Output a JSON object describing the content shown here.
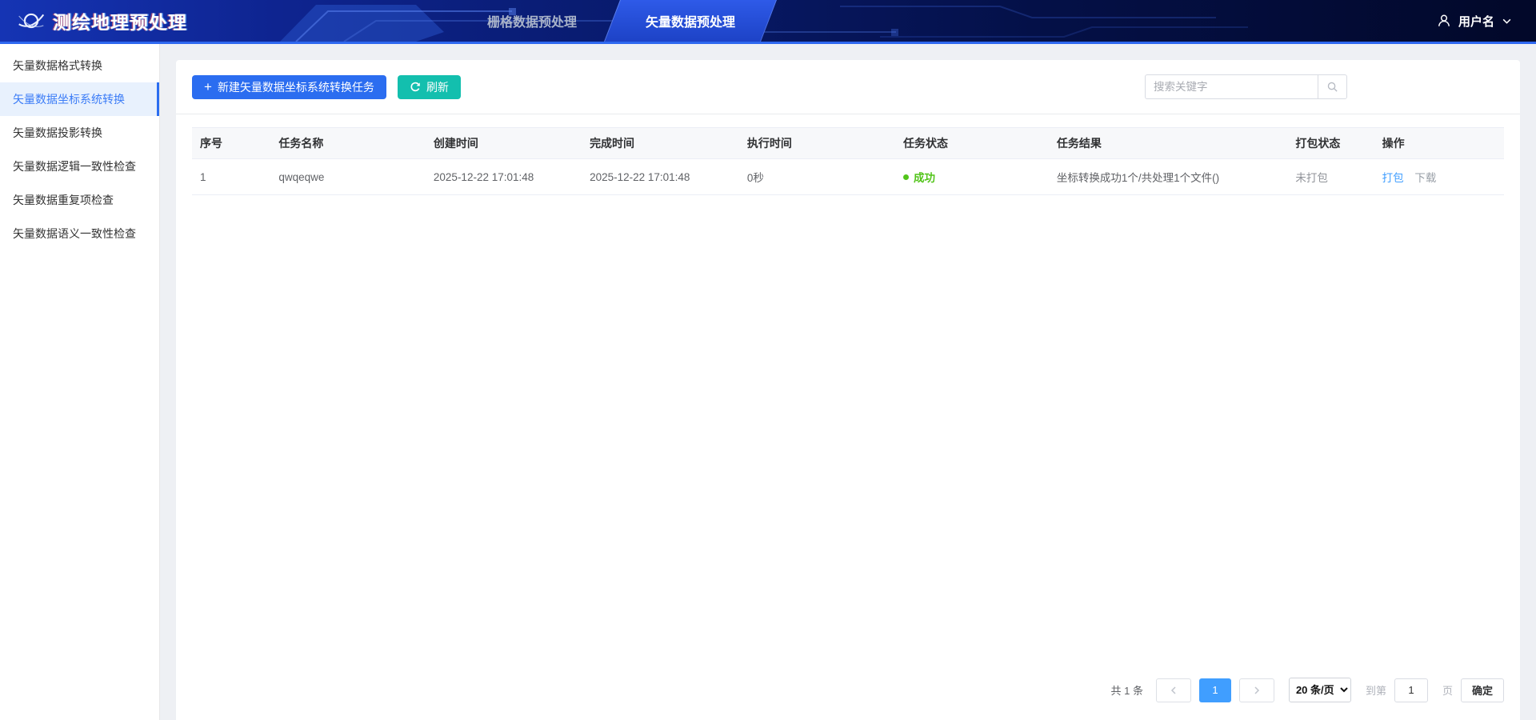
{
  "header": {
    "app_title": "测绘地理预处理",
    "tabs": [
      {
        "label": "栅格数据预处理",
        "active": false
      },
      {
        "label": "矢量数据预处理",
        "active": true
      }
    ],
    "user_name": "用户名"
  },
  "sidebar": {
    "items": [
      {
        "label": "矢量数据格式转换",
        "active": false
      },
      {
        "label": "矢量数据坐标系统转换",
        "active": true
      },
      {
        "label": "矢量数据投影转换",
        "active": false
      },
      {
        "label": "矢量数据逻辑一致性检查",
        "active": false
      },
      {
        "label": "矢量数据重复项检查",
        "active": false
      },
      {
        "label": "矢量数据语义一致性检查",
        "active": false
      }
    ]
  },
  "toolbar": {
    "new_task_label": "新建矢量数据坐标系统转换任务",
    "refresh_label": "刷新",
    "search_placeholder": "搜索关键字"
  },
  "icons": {
    "plus": "+"
  },
  "table": {
    "columns": [
      "序号",
      "任务名称",
      "创建时间",
      "完成时间",
      "执行时间",
      "任务状态",
      "任务结果",
      "打包状态",
      "操作"
    ],
    "rows": [
      {
        "index": "1",
        "name": "qwqeqwe",
        "created": "2025-12-22 17:01:48",
        "finished": "2025-12-22 17:01:48",
        "duration": "0秒",
        "status": "成功",
        "result": "坐标转换成功1个/共处理1个文件()",
        "package_status": "未打包",
        "action_package": "打包",
        "action_download": "下载"
      }
    ]
  },
  "pagination": {
    "total_label": "共 1 条",
    "current_page": "1",
    "page_size_label": "20 条/页",
    "goto_prefix": "到第",
    "goto_value": "1",
    "goto_suffix": "页",
    "confirm_label": "确定"
  },
  "colors": {
    "header_accent": "#2e68f0",
    "primary_button": "#2b6df0",
    "refresh_button": "#13bfae",
    "active_tab": "#2e5ae8",
    "sidebar_active_bg": "#e8f1fd",
    "sidebar_active_text": "#3b7cf7",
    "status_success": "#52c41a",
    "link": "#409eff",
    "pagination_active": "#409eff"
  }
}
